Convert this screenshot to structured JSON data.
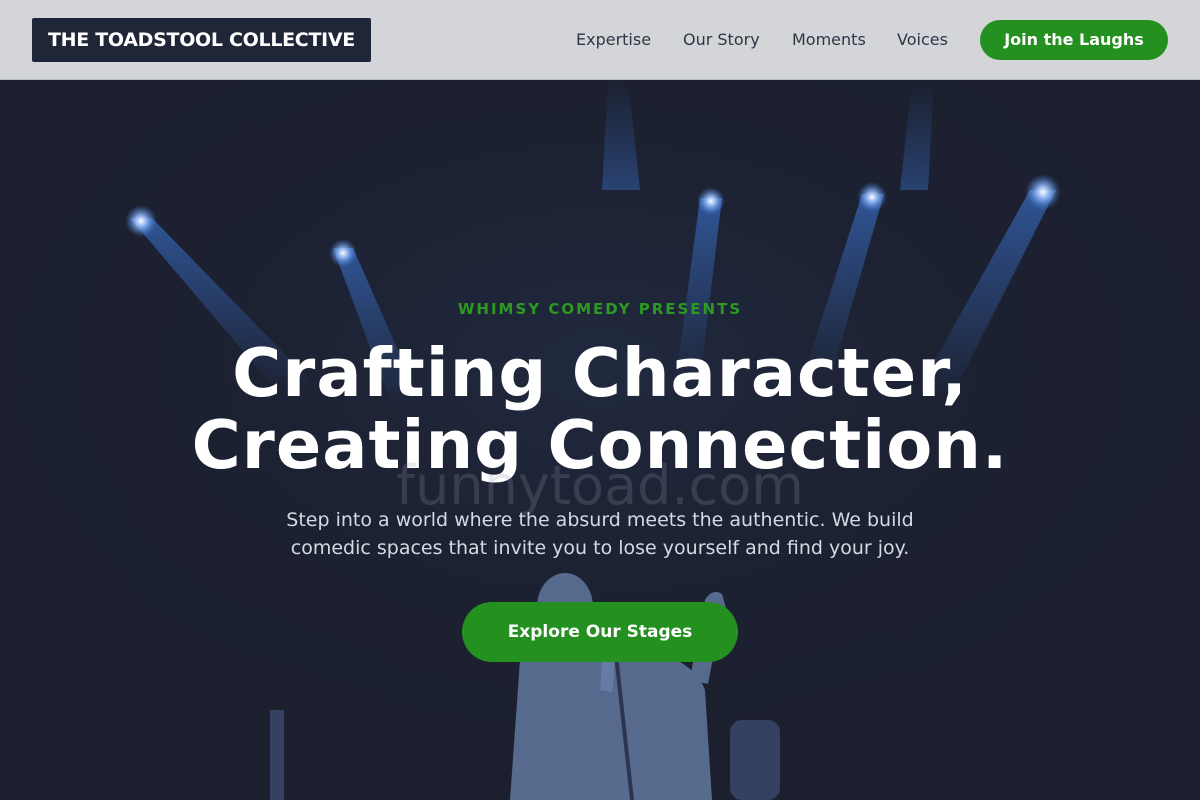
{
  "header": {
    "logo": "THE TOADSTOOL COLLECTIVE",
    "nav": [
      "Expertise",
      "Our Story",
      "Moments",
      "Voices"
    ],
    "cta": "Join the Laughs"
  },
  "hero": {
    "eyebrow": "WHIMSY COMEDY PRESENTS",
    "headline_line1": "Crafting Character,",
    "headline_line2": "Creating Connection.",
    "watermark": "funnytoad.com",
    "subtext_line1": "Step into a world where the absurd meets the authentic. We build",
    "subtext_line2": "comedic spaces that invite you to lose yourself and find your joy.",
    "cta": "Explore Our Stages",
    "background_image": "comedian-on-stage-with-microphone-under-blue-spotlights"
  },
  "colors": {
    "accent_green": "#24901f",
    "eyebrow_green": "#2c9a22",
    "header_bg": "#d4d5d9",
    "logo_bg": "#1e2638",
    "hero_bg": "#1b1f2e",
    "spotlight_blue": "#3f7fe6"
  }
}
